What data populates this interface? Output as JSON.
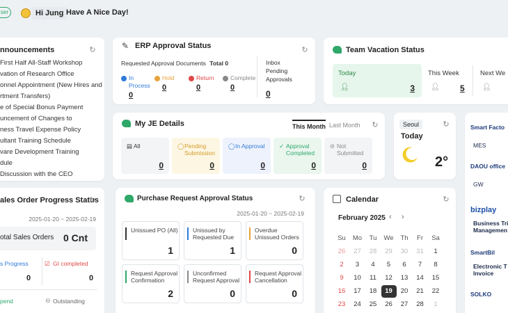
{
  "header": {
    "badge": "ser",
    "greeting_name": "Hi Jung",
    "greeting_msg": "Have A Nice Day!"
  },
  "announcements": {
    "title": "nnouncements",
    "items": [
      "First Half All-Staff Workshop",
      "vation of Research Office",
      "onnel Appointment (New Hires and",
      "rtment Transfers)",
      "e of Special Bonus Payment",
      "uncement of Changes to",
      "ness Travel Expense Policy",
      "ultant Training Schedule",
      "vare Development Training",
      "dule",
      "Discussion with the CEO"
    ]
  },
  "erp": {
    "title": "ERP Approval Status",
    "requested_label": "Requested Approval Documents",
    "total_label": "Total 0",
    "statuses": [
      {
        "label": "In Process",
        "value": "0",
        "color": "#2f7bd8"
      },
      {
        "label": "Hold",
        "value": "0",
        "color": "#e8a33d"
      },
      {
        "label": "Return",
        "value": "0",
        "color": "#e04848"
      },
      {
        "label": "Complete",
        "value": "0",
        "color": "#888888"
      }
    ],
    "inbox_label": "Inbox Pending Approvals",
    "inbox_value": "0"
  },
  "vacation": {
    "title": "Team Vacation Status",
    "today_label": "Today",
    "today_value": "3",
    "week_label": "This Week",
    "week_value": "5",
    "next_label": "Next We"
  },
  "je": {
    "title": "My JE Details",
    "tab_this_month": "This Month",
    "tab_last_month": "Last Month",
    "items": [
      {
        "label": "All",
        "value": "0"
      },
      {
        "label": "Pending Submission",
        "value": "0"
      },
      {
        "label": "In Approval",
        "value": "0"
      },
      {
        "label": "Approval Completed",
        "value": "0"
      },
      {
        "label": "Not Submitted",
        "value": "0"
      }
    ]
  },
  "weather": {
    "city": "Seoul",
    "day": "Today",
    "temp": "2°"
  },
  "apps": {
    "items": [
      {
        "logo": "Smart Facto",
        "label": "MES"
      },
      {
        "logo": "DAOU office",
        "label": "GW"
      },
      {
        "logo": "bizplay",
        "label": "Business Tri Managemen"
      },
      {
        "logo": "SmartBil",
        "label": "Electronic T Invoice"
      },
      {
        "logo": "SOLKO",
        "label": ""
      }
    ]
  },
  "sales": {
    "title": "ales Order Progress Status",
    "range": "2025-01-20 ~ 2025-02-19",
    "total_label": "otal Sales Orders",
    "total_value": "0 Cnt",
    "progress_label": "s Progress",
    "progress_value": "0",
    "gi_label": "GI completed",
    "gi_value": "0",
    "spend_label": "pend",
    "outstanding_label": "Outstanding"
  },
  "purchase": {
    "title": "Purchase Request Approval Status",
    "range": "2025-01-20 ~ 2025-02-19",
    "boxes": [
      {
        "label": "Unissued PO (All)",
        "value": "1",
        "color": "#333333"
      },
      {
        "label": "Unissued by Requested Due",
        "value": "1",
        "color": "#2f7bd8"
      },
      {
        "label": "Overdue Unissued Orders",
        "value": "0",
        "color": "#e8a33d"
      },
      {
        "label": "Request Approval Confirmation",
        "value": "2",
        "color": "#2fa86a"
      },
      {
        "label": "Unconfirmed Request Approval",
        "value": "0",
        "color": "#888888"
      },
      {
        "label": "Request Approval Cancellation",
        "value": "0",
        "color": "#e04848"
      }
    ]
  },
  "calendar": {
    "title": "Calendar",
    "month": "February 2025",
    "weekdays": [
      "Su",
      "Mo",
      "Tu",
      "We",
      "Th",
      "Fr",
      "Sa"
    ],
    "weeks": [
      [
        "26",
        "27",
        "28",
        "29",
        "30",
        "31",
        "1"
      ],
      [
        "2",
        "3",
        "4",
        "5",
        "6",
        "7",
        "8"
      ],
      [
        "9",
        "10",
        "11",
        "12",
        "13",
        "14",
        "15"
      ],
      [
        "16",
        "17",
        "18",
        "19",
        "20",
        "21",
        "22"
      ],
      [
        "23",
        "24",
        "25",
        "26",
        "27",
        "28",
        "1"
      ]
    ],
    "today": "19"
  }
}
